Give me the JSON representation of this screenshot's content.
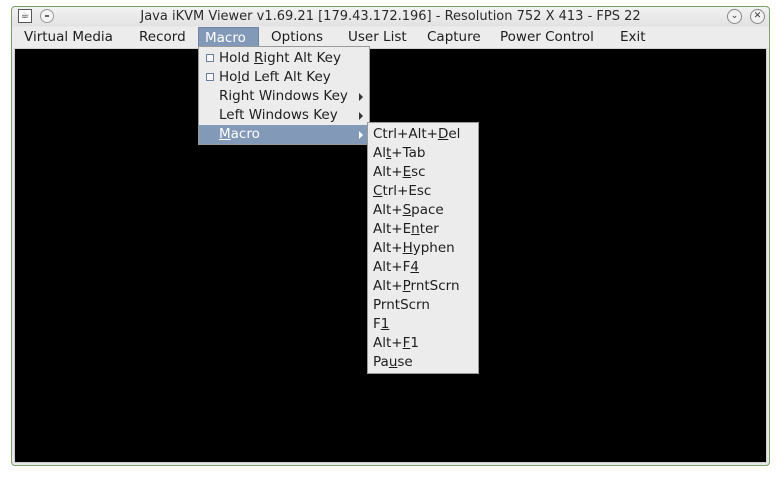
{
  "window": {
    "title": "Java iKVM Viewer v1.69.21 [179.43.172.196]  - Resolution 752 X 413 - FPS 22",
    "icons": [
      "java-icon",
      "window-menu-icon",
      "minimize-icon",
      "close-icon"
    ]
  },
  "menubar": {
    "items": [
      {
        "label": "Virtual Media"
      },
      {
        "label": "Record"
      },
      {
        "label": "Macro",
        "active": true
      },
      {
        "label": "Options"
      },
      {
        "label": "User List"
      },
      {
        "label": "Capture"
      },
      {
        "label": "Power Control"
      },
      {
        "label": "Exit"
      }
    ]
  },
  "macro_menu": {
    "items": [
      {
        "pre": "Hold ",
        "u": "R",
        "post": "ight Alt Key",
        "checkbox": true,
        "checked": false
      },
      {
        "pre": "Ho",
        "u": "l",
        "post": "d Left Alt Key",
        "checkbox": true,
        "checked": false
      },
      {
        "pre": "Right Windows Key",
        "u": "",
        "post": "",
        "submenu": true
      },
      {
        "pre": "Left Windows Key",
        "u": "",
        "post": "",
        "submenu": true
      },
      {
        "pre": "",
        "u": "M",
        "post": "acro",
        "submenu": true,
        "highlighted": true
      }
    ]
  },
  "macro_submenu": {
    "items": [
      {
        "pre": "Ctrl+Alt+",
        "u": "D",
        "post": "el"
      },
      {
        "pre": "Al",
        "u": "t",
        "post": "+Tab"
      },
      {
        "pre": "Alt+",
        "u": "E",
        "post": "sc"
      },
      {
        "pre": "",
        "u": "C",
        "post": "trl+Esc"
      },
      {
        "pre": "Alt+",
        "u": "S",
        "post": "pace"
      },
      {
        "pre": "Alt+E",
        "u": "n",
        "post": "ter"
      },
      {
        "pre": "Alt+",
        "u": "H",
        "post": "yphen"
      },
      {
        "pre": "Alt+F",
        "u": "4",
        "post": ""
      },
      {
        "pre": "Alt+",
        "u": "P",
        "post": "rntScrn"
      },
      {
        "pre": "PrntScrn",
        "u": "",
        "post": ""
      },
      {
        "pre": "F",
        "u": "1",
        "post": ""
      },
      {
        "pre": "Alt+",
        "u": "F",
        "post": "1"
      },
      {
        "pre": "Pa",
        "u": "u",
        "post": "se"
      }
    ]
  },
  "colors": {
    "menu_highlight": "#8399b8",
    "screen_background": "#000000",
    "window_border": "#7aa26a"
  }
}
